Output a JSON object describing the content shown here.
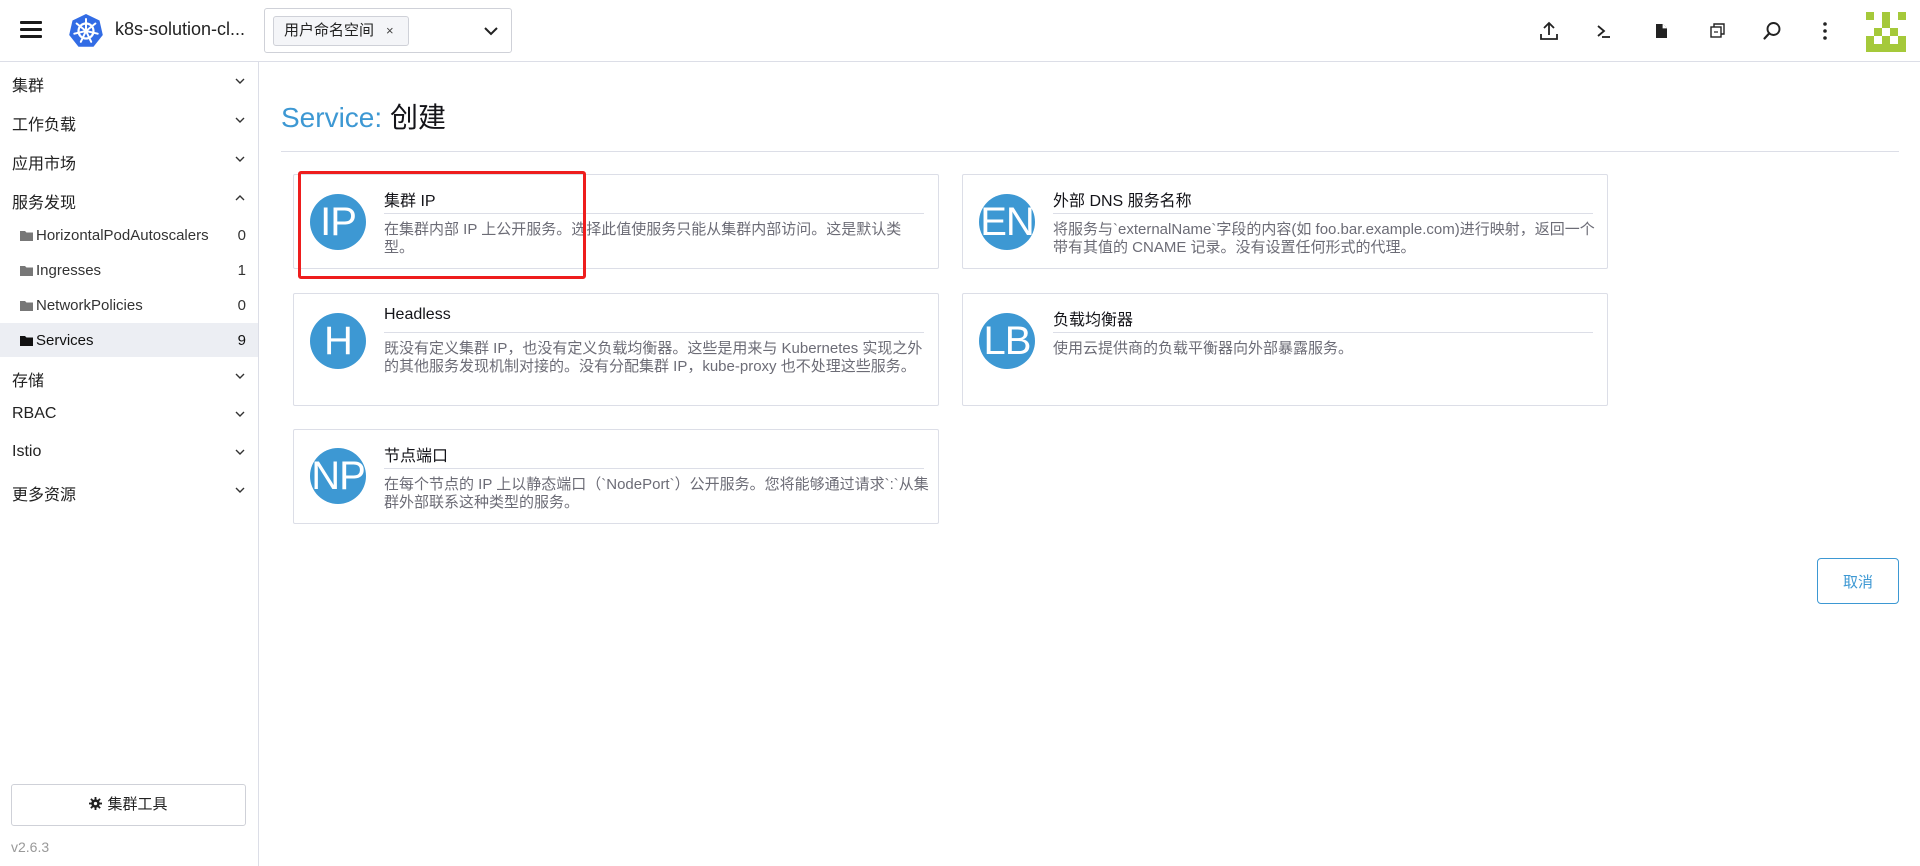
{
  "header": {
    "cluster_name": "k8s-solution-cl...",
    "namespace_chip": "用户命名空间",
    "chip_remove": "×",
    "icons": [
      "upload-icon",
      "terminal-icon",
      "file-icon",
      "copy-kubeconfig-icon",
      "search-icon",
      "more-vertical-icon"
    ]
  },
  "sidebar": {
    "groups": [
      {
        "label": "集群",
        "expanded": false
      },
      {
        "label": "工作负载",
        "expanded": false
      },
      {
        "label": "应用市场",
        "expanded": false
      },
      {
        "label": "服务发现",
        "expanded": true
      },
      {
        "label": "存储",
        "expanded": false
      },
      {
        "label": "RBAC",
        "expanded": false
      },
      {
        "label": "Istio",
        "expanded": false
      },
      {
        "label": "更多资源",
        "expanded": false
      }
    ],
    "items": [
      {
        "label": "HorizontalPodAutoscalers",
        "count": "0"
      },
      {
        "label": "Ingresses",
        "count": "1"
      },
      {
        "label": "NetworkPolicies",
        "count": "0"
      },
      {
        "label": "Services",
        "count": "9",
        "active": true
      }
    ],
    "cluster_tools": "集群工具",
    "version": "v2.6.3"
  },
  "main": {
    "title_kind": "Service:",
    "title_action": "创建",
    "cards": [
      {
        "badge": "IP",
        "title": "集群 IP",
        "desc": "在集群内部 IP 上公开服务。选择此值使服务只能从集群内部访问。这是默认类型。"
      },
      {
        "badge": "EN",
        "title": "外部 DNS 服务名称",
        "desc": "将服务与`externalName`字段的内容(如 foo.bar.example.com)进行映射，返回一个带有其值的 CNAME 记录。没有设置任何形式的代理。"
      },
      {
        "badge": "H",
        "title": "Headless",
        "desc": "既没有定义集群 IP，也没有定义负载均衡器。这些是用来与 Kubernetes 实现之外的其他服务发现机制对接的。没有分配集群 IP，kube-proxy 也不处理这些服务。"
      },
      {
        "badge": "LB",
        "title": "负载均衡器",
        "desc": "使用云提供商的负载平衡器向外部暴露服务。"
      },
      {
        "badge": "NP",
        "title": "节点端口",
        "desc": "在每个节点的 IP 上以静态端口（`NodePort`）公开服务。您将能够通过请求`:`从集群外部联系这种类型的服务。"
      }
    ],
    "cancel_label": "取消"
  },
  "colors": {
    "accent": "#3d98d3",
    "highlight": "#ee1d1d",
    "border": "#dcdee7",
    "active_bg": "#eceef3",
    "avatar_green": "#a5c93a"
  }
}
